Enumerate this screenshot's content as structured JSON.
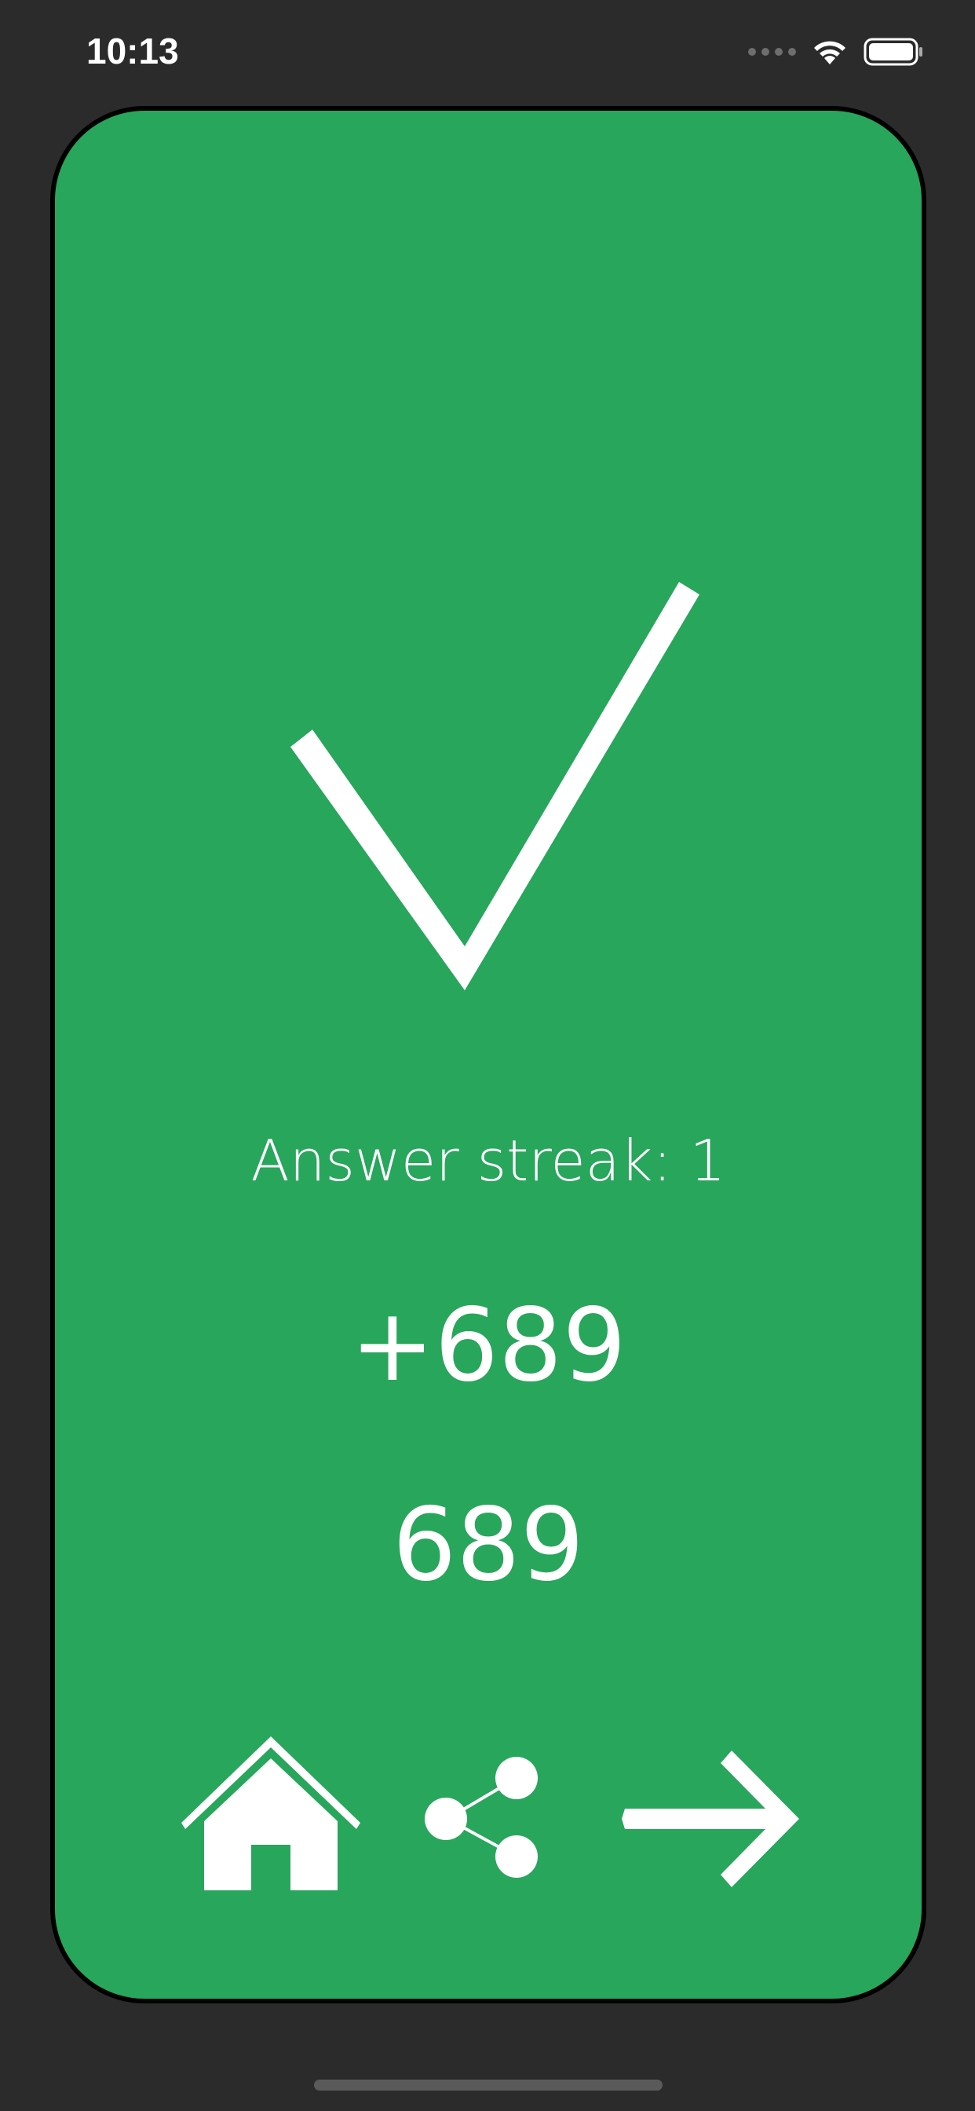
{
  "status_bar": {
    "time": "10:13"
  },
  "result": {
    "icon": "checkmark-icon",
    "streak_label": "Answer streak: 1",
    "points_delta": "+689",
    "points_total": "689"
  },
  "actions": {
    "home_icon": "home-icon",
    "share_icon": "share-icon",
    "next_icon": "arrow-right-icon"
  },
  "colors": {
    "background": "#2b2b2b",
    "card": "#27a65c",
    "foreground": "#ffffff"
  }
}
